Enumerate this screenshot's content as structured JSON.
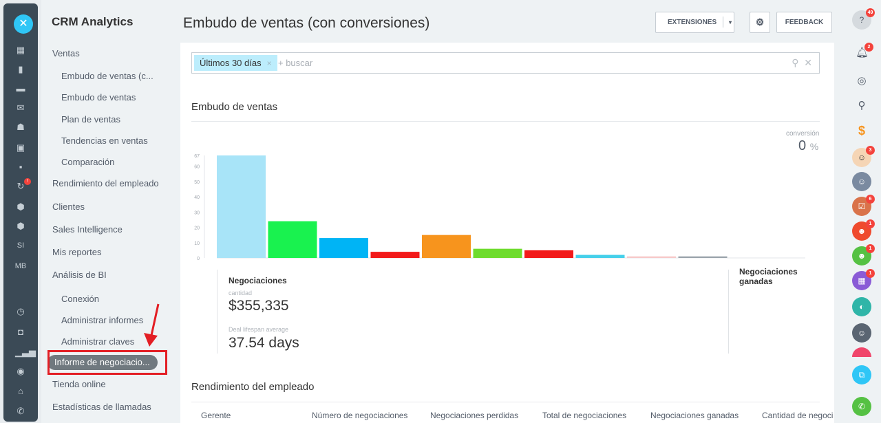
{
  "rail": {
    "close_icon": "close-icon",
    "labels": [
      "SI",
      "MB"
    ]
  },
  "sidebar": {
    "title": "CRM Analytics",
    "items": [
      {
        "label": "Ventas",
        "level": "top"
      },
      {
        "label": "Embudo de ventas (c...",
        "level": "sub"
      },
      {
        "label": "Embudo de ventas",
        "level": "sub"
      },
      {
        "label": "Plan de ventas",
        "level": "sub"
      },
      {
        "label": "Tendencias en ventas",
        "level": "sub"
      },
      {
        "label": "Comparación",
        "level": "sub"
      },
      {
        "label": "Rendimiento del empleado",
        "level": "top"
      },
      {
        "label": "Clientes",
        "level": "top"
      },
      {
        "label": "Sales Intelligence",
        "level": "top"
      },
      {
        "label": "Mis reportes",
        "level": "top"
      },
      {
        "label": "Análisis de BI",
        "level": "top"
      },
      {
        "label": "Conexión",
        "level": "sub"
      },
      {
        "label": "Administrar informes",
        "level": "sub"
      },
      {
        "label": "Administrar claves",
        "level": "sub"
      },
      {
        "label": "Informe de negociacio...",
        "level": "active"
      },
      {
        "label": "Tienda online",
        "level": "top"
      },
      {
        "label": "Estadísticas de llamadas",
        "level": "top"
      }
    ]
  },
  "header": {
    "title": "Embudo de ventas (con conversiones)",
    "extensions_label": "EXTENSIONES",
    "feedback_label": "FEEDBACK"
  },
  "filter": {
    "tag": "Últimos 30 días",
    "placeholder": "+ buscar"
  },
  "funnel": {
    "section_title": "Embudo de ventas",
    "conversion_label": "conversión",
    "conversion_value": "0",
    "conversion_unit": "%"
  },
  "chart_data": {
    "type": "bar",
    "categories": [
      "",
      "",
      "",
      "",
      "",
      "",
      "",
      "",
      "",
      ""
    ],
    "values": [
      67,
      24,
      13,
      4,
      15,
      6,
      5,
      2,
      1,
      1
    ],
    "colors": [
      "#a8e4f8",
      "#19f24f",
      "#00b4f5",
      "#f21a1a",
      "#f7941d",
      "#6fdc2e",
      "#f21a1a",
      "#45d0ea",
      "#f7c8c8",
      "#9aa3ab"
    ],
    "yticks": [
      0,
      10,
      20,
      30,
      40,
      50,
      60,
      67
    ],
    "ylim": [
      0,
      67
    ],
    "title": "",
    "xlabel": "",
    "ylabel": ""
  },
  "stats": {
    "deals_heading": "Negociaciones",
    "amount_label": "cantidad",
    "amount_value": "$355,335",
    "lifespan_label": "Deal lifespan average",
    "lifespan_value": "37.54 days",
    "won_heading": "Negociaciones ganadas"
  },
  "employee": {
    "section_title": "Rendimiento del empleado",
    "columns": [
      "Gerente",
      "Número de negociaciones",
      "Negociaciones perdidas",
      "Total de negociaciones",
      "Negociaciones ganadas",
      "Cantidad de negoci"
    ]
  },
  "right_rail": {
    "badges": [
      "49",
      "2",
      "3",
      "6",
      "1",
      "1",
      "1"
    ]
  }
}
